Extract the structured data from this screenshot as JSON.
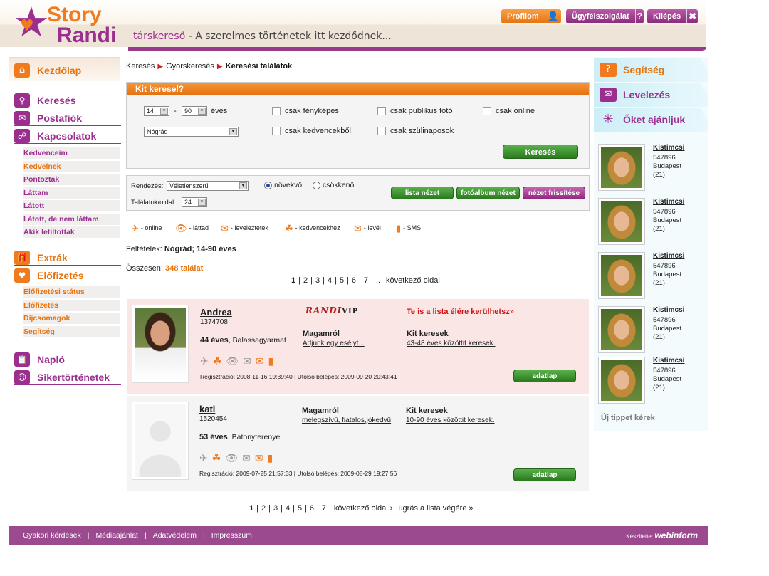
{
  "header": {
    "logo_top": "Story",
    "logo_bottom": "Randi",
    "tagline_brand": "társkereső",
    "tagline_rest": " - A szerelmes történetek itt kezdődnek...",
    "btn_profile": "Profilom",
    "btn_support": "Ügyfélszolgálat",
    "btn_logout": "Kilépés"
  },
  "left_nav": {
    "home": "Kezdőlap",
    "search": "Keresés",
    "mailbox": "Postafiók",
    "contacts": "Kapcsolatok",
    "contact_items": [
      "Kedvenceim",
      "Kedvelnek",
      "Pontoztak",
      "Láttam",
      "Látott",
      "Látott, de nem láttam",
      "Akik letiltottak"
    ],
    "extras": "Extrák",
    "subscription": "Előfizetés",
    "subscription_items": [
      "Előfizetési státus",
      "Előfizetés",
      "Díjcsomagok",
      "Segítség"
    ],
    "diary": "Napló",
    "success": "Sikertörténetek"
  },
  "breadcrumb": [
    "Keresés",
    "Gyorskeresés",
    "Keresési találatok"
  ],
  "search": {
    "title": "Kit keresel?",
    "age_from": "14",
    "age_sep": "-",
    "age_to": "90",
    "age_unit": "éves",
    "region": "Nógrád",
    "checks": [
      "csak fényképes",
      "csak publikus fotó",
      "csak online",
      "csak kedvencekből",
      "csak szülinaposok"
    ],
    "submit": "Keresés"
  },
  "sort": {
    "label": "Rendezés:",
    "value": "Véletlenszerű",
    "asc": "növekvő",
    "desc": "csökkenő",
    "per_page_label": "Találatok/oldal",
    "per_page": "24",
    "btn_list": "lista nézet",
    "btn_album": "fotóalbum nézet",
    "btn_refresh": "nézet frissítése"
  },
  "legend": [
    "- online",
    "- láttad",
    "- leveleztetek",
    "- kedvencekhez",
    "- levél",
    "- SMS"
  ],
  "conditions_label": "Feltételek:",
  "conditions_value": "Nógrád; 14-90 éves",
  "total_label": "Összesen:",
  "total_value": "348 találat",
  "pager_top": {
    "pages": [
      "1",
      "2",
      "3",
      "4",
      "5",
      "6",
      "7"
    ],
    "more": "..",
    "next": "következő oldal"
  },
  "results": [
    {
      "name": "Andrea",
      "id": "1374708",
      "age": "44 éves",
      "city": ", Balassagyarmat",
      "about_h": "Magamról",
      "about": "Adjunk egy esélyt...",
      "seek_h": "Kit keresek",
      "seek": "43-48 éves közöttit keresek.",
      "reg": "Regisztráció: 2008-11-16 19:39:40 | Utolsó belépés: 2009-09-20 20:43:41",
      "btn": "adatlap",
      "vip_a": "RANDI",
      "vip_b": "VIP",
      "promo": "Te is a lista élére kerülhetsz»"
    },
    {
      "name": "kati",
      "id": "1520454",
      "age": "53 éves",
      "city": ", Bátonyterenye",
      "about_h": "Magamról",
      "about": "melegszívű, fiatalos,jókedvű",
      "seek_h": "Kit keresek",
      "seek": "10-90 éves közöttit keresek.",
      "reg": "Regisztráció: 2009-07-25 21:57:33 | Utolsó belépés: 2009-08-29 19:27:56",
      "btn": "adatlap"
    }
  ],
  "pager_bottom": {
    "pages": [
      "1",
      "2",
      "3",
      "4",
      "5",
      "6",
      "7"
    ],
    "next": "következő oldal ›",
    "last": "ugrás a lista végére »"
  },
  "right_nav": {
    "help": "Segítség",
    "mail": "Levelezés",
    "recommend": "Őket ajánljuk",
    "recs": [
      {
        "name": "Kistimcsi",
        "id": "547896",
        "city": "Budapest",
        "age": "(21)"
      },
      {
        "name": "Kistimcsi",
        "id": "547896",
        "city": "Budapest",
        "age": "(21)"
      },
      {
        "name": "Kistimcsi",
        "id": "547896",
        "city": "Budapest",
        "age": "(21)"
      },
      {
        "name": "Kistimcsi",
        "id": "547896",
        "city": "Budapest",
        "age": "(21)"
      },
      {
        "name": "Kistimcsi",
        "id": "547896",
        "city": "Budapest",
        "age": "(21)"
      }
    ],
    "new_tip": "Új tippet kérek"
  },
  "footer": {
    "links": [
      "Gyakori kérdések",
      "Médiaajánlat",
      "Adatvédelem",
      "Impresszum"
    ],
    "made_by": "Készítette:",
    "maker": "webinform"
  }
}
